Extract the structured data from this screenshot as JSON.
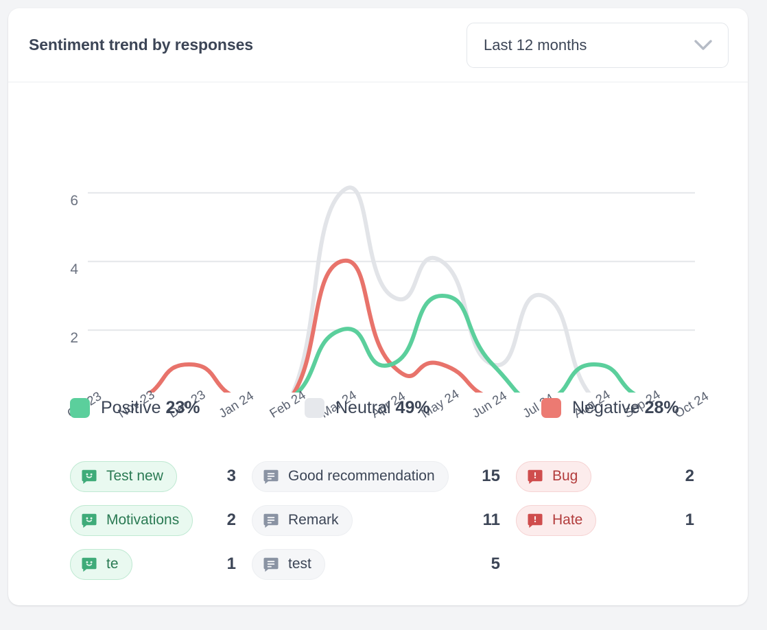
{
  "header": {
    "title": "Sentiment trend by responses",
    "range_select": {
      "value": "Last 12 months",
      "icon": "chevron-down-icon"
    }
  },
  "chart_data": {
    "type": "line",
    "title": "Sentiment trend by responses",
    "xlabel": "",
    "ylabel": "",
    "grid": true,
    "ylim": [
      0,
      6
    ],
    "yticks": [
      "0",
      "2",
      "4",
      "6"
    ],
    "legend_position": "below",
    "categories": [
      "Oct 23",
      "Nov 23",
      "Dec 23",
      "Jan 24",
      "Feb 24",
      "Mar 24",
      "Apr 24",
      "May 24",
      "Jun 24",
      "Jul 24",
      "Aug 24",
      "Sep 24",
      "Oct 24"
    ],
    "series": [
      {
        "name": "Positive",
        "color": "#5bcf9c",
        "values": [
          0,
          0,
          0,
          0,
          0,
          2,
          1,
          3,
          1,
          0,
          1,
          0,
          0
        ]
      },
      {
        "name": "Neutral",
        "color": "#e2e4e8",
        "values": [
          0,
          0,
          0,
          0,
          0,
          6,
          3,
          4,
          1,
          3,
          0,
          0,
          0
        ]
      },
      {
        "name": "Negative",
        "color": "#e8736b",
        "values": [
          0,
          0,
          1,
          0,
          0,
          4,
          1,
          1,
          0,
          0,
          0,
          null,
          null
        ]
      }
    ]
  },
  "legend": [
    {
      "key": "positive",
      "label": "Positive",
      "percent": "23%",
      "color": "#5bcf9c",
      "chip_icon": "smiley-speech-bubble-icon",
      "chips": [
        {
          "label": "Test new",
          "count": "3"
        },
        {
          "label": "Motivations",
          "count": "2"
        },
        {
          "label": "te",
          "count": "1"
        }
      ]
    },
    {
      "key": "neutral",
      "label": "Neutral",
      "percent": "49%",
      "color": "#e6e8ec",
      "chip_icon": "lines-speech-bubble-icon",
      "chips": [
        {
          "label": "Good recommendation",
          "count": "15"
        },
        {
          "label": "Remark",
          "count": "11"
        },
        {
          "label": "test",
          "count": "5"
        }
      ]
    },
    {
      "key": "negative",
      "label": "Negative",
      "percent": "28%",
      "color": "#ec7a72",
      "chip_icon": "alert-speech-bubble-icon",
      "chips": [
        {
          "label": "Bug",
          "count": "2"
        },
        {
          "label": "Hate",
          "count": "1"
        }
      ]
    }
  ]
}
